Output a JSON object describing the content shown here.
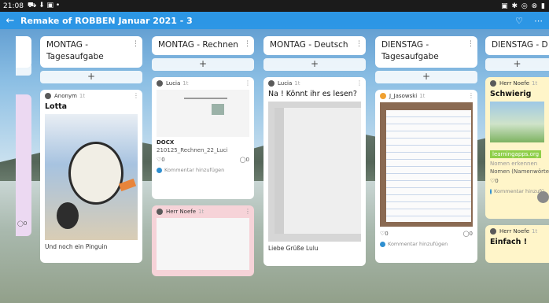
{
  "status": {
    "time": "21:08",
    "icons_left": "⛟ ⬇ ▣ •",
    "icons_right": "▣ ✱ ◎ ⊗ ▮"
  },
  "appbar": {
    "back_icon": "←",
    "title": "Remake of ROBBEN Januar 2021 - 3",
    "heart_icon": "♡",
    "more_icon": "⋯"
  },
  "columns": [
    {
      "title": "MONTAG - Tagesaufgabe",
      "add": "+",
      "cards": [
        {
          "author": "Anonym",
          "time": "1t",
          "title": "Lotta",
          "text": "Und noch ein Pinguin"
        }
      ]
    },
    {
      "title": "MONTAG - Rechnen",
      "add": "+",
      "cards": [
        {
          "author": "Lucia",
          "time": "1t",
          "doc_type": "DOCX",
          "doc_name": "210125_Rechnen_22_Luci",
          "likes": "0",
          "comments": "0",
          "comment_prompt": "Kommentar hinzufügen"
        },
        {
          "author": "Herr Noefe",
          "time": "1t"
        }
      ]
    },
    {
      "title": "MONTAG - Deutsch",
      "add": "+",
      "cards": [
        {
          "author": "Lucia",
          "time": "1t",
          "title": "Na ! Könnt ihr es lesen?",
          "text": "Liebe Grüße Lulu"
        }
      ]
    },
    {
      "title": "DIENSTAG - Tagesaufgabe",
      "add": "+",
      "cards": [
        {
          "author": "J_Jasowski",
          "time": "1t",
          "likes": "0",
          "comments": "0",
          "comment_prompt": "Kommentar hinzufügen"
        }
      ]
    },
    {
      "title": "DIENSTAG - D",
      "add": "+",
      "cards": [
        {
          "author": "Herr Noefe",
          "time": "1t",
          "title": "Schwierig",
          "link": "learningapps.org",
          "sub1": "Nomen erkennen",
          "sub2": "Nomen (Namenwörter)",
          "likes": "0",
          "comment_prompt": "Kommentar hinzufü"
        },
        {
          "author": "Herr Noefe",
          "time": "1t",
          "title": "Einfach !"
        }
      ]
    }
  ],
  "left_partial": {
    "comments": "0"
  }
}
